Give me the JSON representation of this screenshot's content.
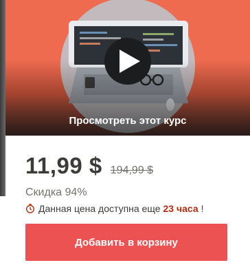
{
  "preview": {
    "label": "Просмотреть этот курс"
  },
  "pricing": {
    "current_price": "11,99 $",
    "original_price": "194,99 $",
    "discount_text": "Скидка 94%",
    "timer_text": "Данная цена доступна еще",
    "timer_hours": "23 часа",
    "timer_suffix": "!"
  },
  "actions": {
    "add_to_cart_label": "Добавить в корзину"
  },
  "colors": {
    "preview_bg": "#ee6b4f",
    "accent_red": "#ec5252",
    "timer_accent": "#b32d0f",
    "price_text": "#3c3b37"
  },
  "icons": {
    "play": "play-icon",
    "timer": "alarm-clock-icon"
  }
}
